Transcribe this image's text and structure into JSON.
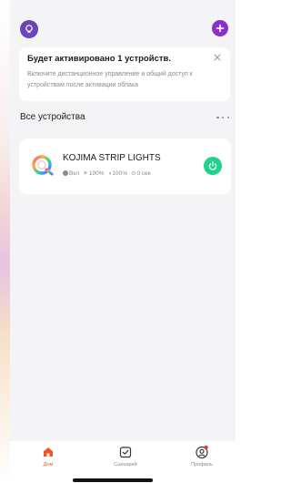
{
  "colors": {
    "accent": "#8b2fc9",
    "power_on": "#1ed38b",
    "active_tab": "#f0561e"
  },
  "header": {
    "home_icon": "home-switch-icon",
    "add_icon": "plus-icon"
  },
  "notice": {
    "title": "Будет активировано 1 устройств.",
    "body": "Включите дистанционное управление и общий доступ к устройствам после активации облака",
    "close_icon": "close-icon"
  },
  "devices_section": {
    "title": "Все устройства",
    "more_icon": "more-icon"
  },
  "devices": [
    {
      "name": "KOJIMA STRIP LIGHTS",
      "icon": "rainbow-ring-icon",
      "status": "Вкл",
      "brightness": "100%",
      "color_temp": "100%",
      "timer": "0 сек",
      "power": "on"
    }
  ],
  "tabbar": {
    "tabs": [
      {
        "label": "Дом",
        "icon": "home-icon",
        "active": true
      },
      {
        "label": "Сценарий",
        "icon": "checkbox-icon",
        "active": false
      },
      {
        "label": "Профиль",
        "icon": "profile-icon",
        "active": false
      }
    ]
  }
}
